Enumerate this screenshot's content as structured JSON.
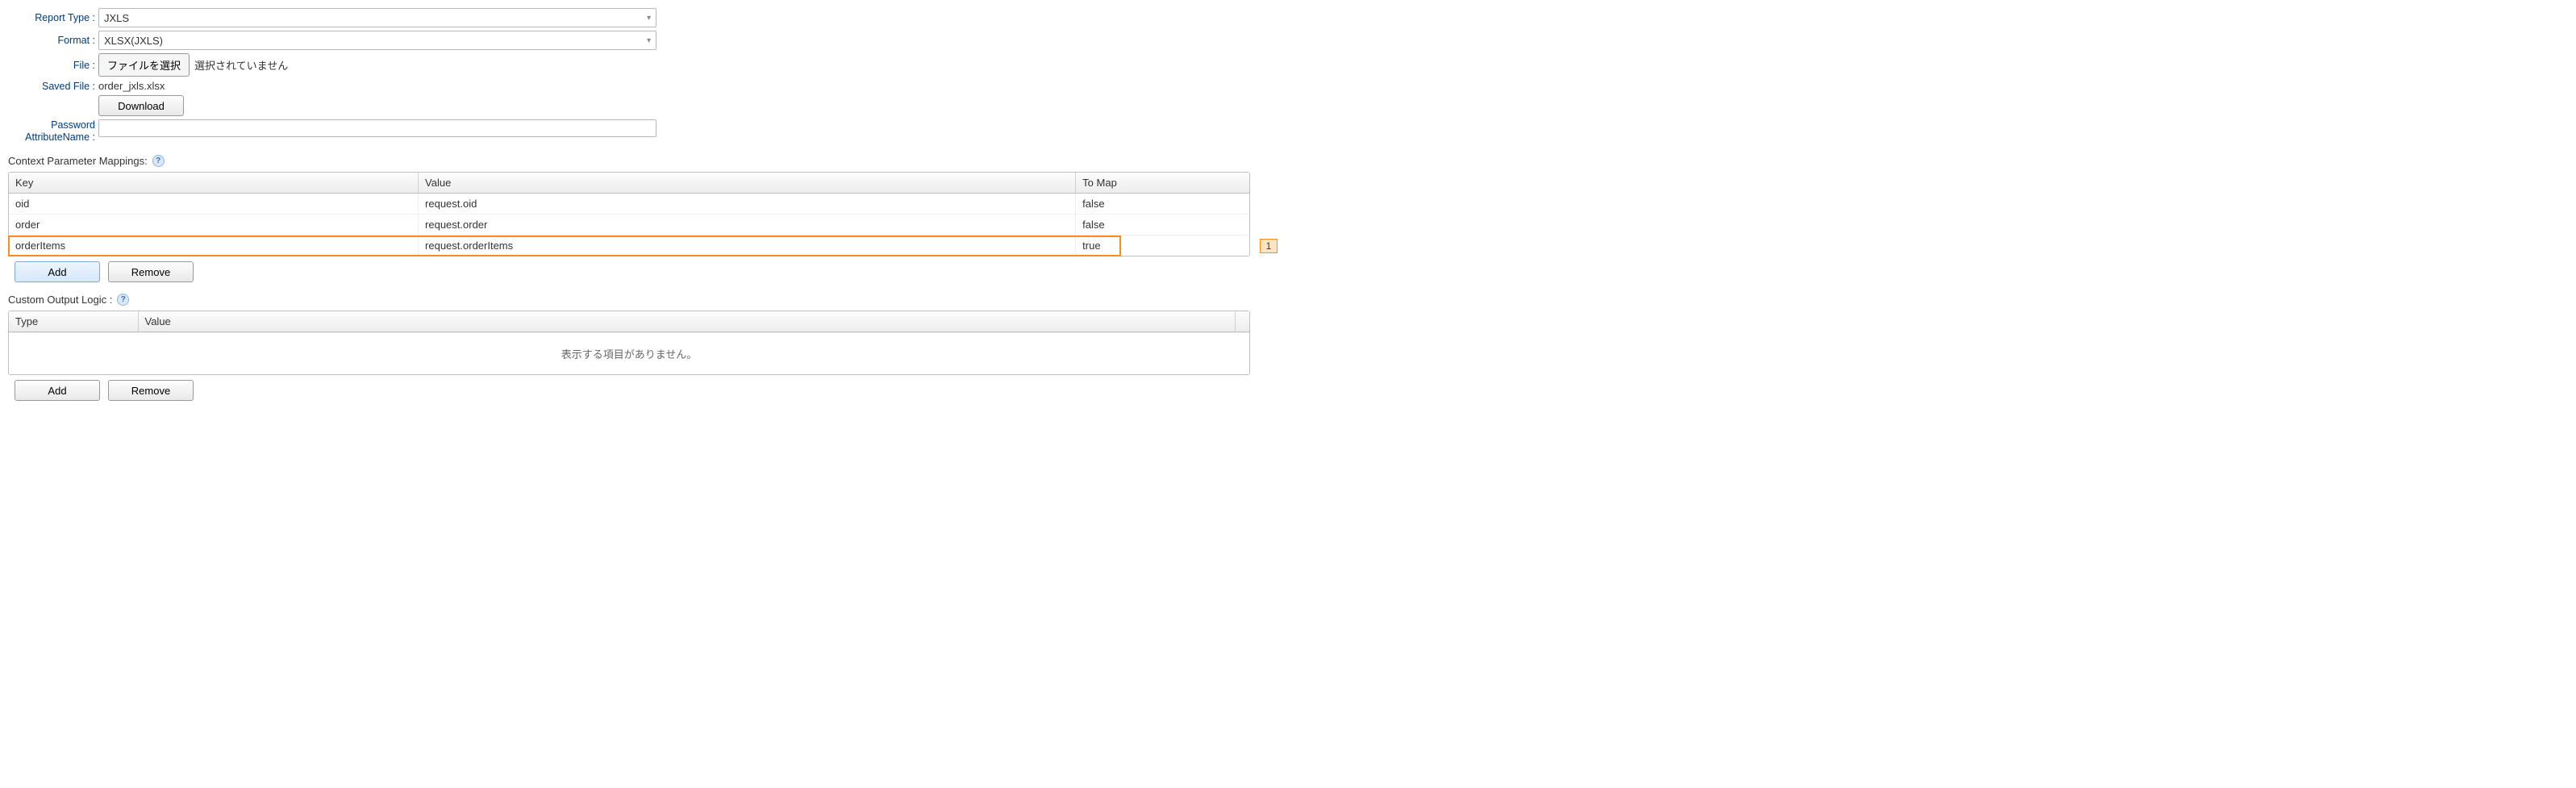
{
  "form": {
    "reportType": {
      "label": "Report Type :",
      "value": "JXLS"
    },
    "format": {
      "label": "Format :",
      "value": "XLSX(JXLS)"
    },
    "file": {
      "label": "File :",
      "choose_button": "ファイルを選択",
      "status": "選択されていません"
    },
    "savedFile": {
      "label": "Saved File :",
      "value": "order_jxls.xlsx",
      "download_button": "Download"
    },
    "passwordAttr": {
      "label": "Password\nAttributeName :",
      "value": ""
    }
  },
  "contextParam": {
    "section_label": "Context Parameter Mappings:",
    "columns": {
      "key": "Key",
      "value": "Value",
      "tomap": "To Map"
    },
    "rows": [
      {
        "key": "oid",
        "value": "request.oid",
        "tomap": "false"
      },
      {
        "key": "order",
        "value": "request.order",
        "tomap": "false"
      },
      {
        "key": "orderItems",
        "value": "request.orderItems",
        "tomap": "true",
        "highlighted": true
      }
    ],
    "highlight_badge": "1",
    "add_button": "Add",
    "remove_button": "Remove"
  },
  "customOutput": {
    "section_label": "Custom Output Logic :",
    "columns": {
      "type": "Type",
      "value": "Value"
    },
    "empty_text": "表示する項目がありません。",
    "add_button": "Add",
    "remove_button": "Remove"
  }
}
